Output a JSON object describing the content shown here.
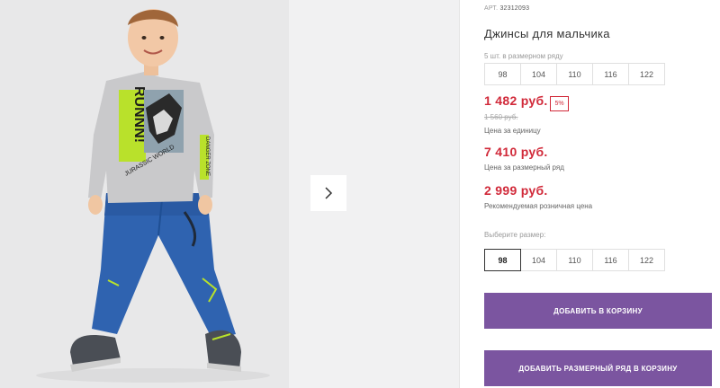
{
  "product": {
    "art_label": "АРТ.",
    "art_value": "32312093",
    "title": "Джинсы для мальчика",
    "row_note": "5 шт. в размерном ряду",
    "row_sizes": [
      "98",
      "104",
      "110",
      "116",
      "122"
    ],
    "unit_price": "1 482 руб.",
    "discount_badge": "5%",
    "old_price": "1 560 руб.",
    "unit_price_caption": "Цена за единицу",
    "row_price": "7 410 руб.",
    "row_price_caption": "Цена за размерный ряд",
    "retail_price": "2 999 руб.",
    "retail_price_caption": "Рекомендуемая розничная цена",
    "choose_size_label": "Выберите размер:",
    "size_options": [
      "98",
      "104",
      "110",
      "116",
      "122"
    ],
    "selected_size": "98",
    "add_to_cart_label": "ДОБАВИТЬ В КОРЗИНУ",
    "add_row_to_cart_label": "ДОБАВИТЬ РАЗМЕРНЫЙ РЯД В КОРЗИНУ"
  },
  "shirt_print": {
    "headline": "RUNNN!",
    "side_text": "DANGER ZONE",
    "world_text": "JURASSIC WORLD"
  },
  "colors": {
    "accent_red": "#d12a3a",
    "button_purple": "#7b55a0"
  },
  "icons": {
    "next_arrow": "chevron-right-icon"
  }
}
